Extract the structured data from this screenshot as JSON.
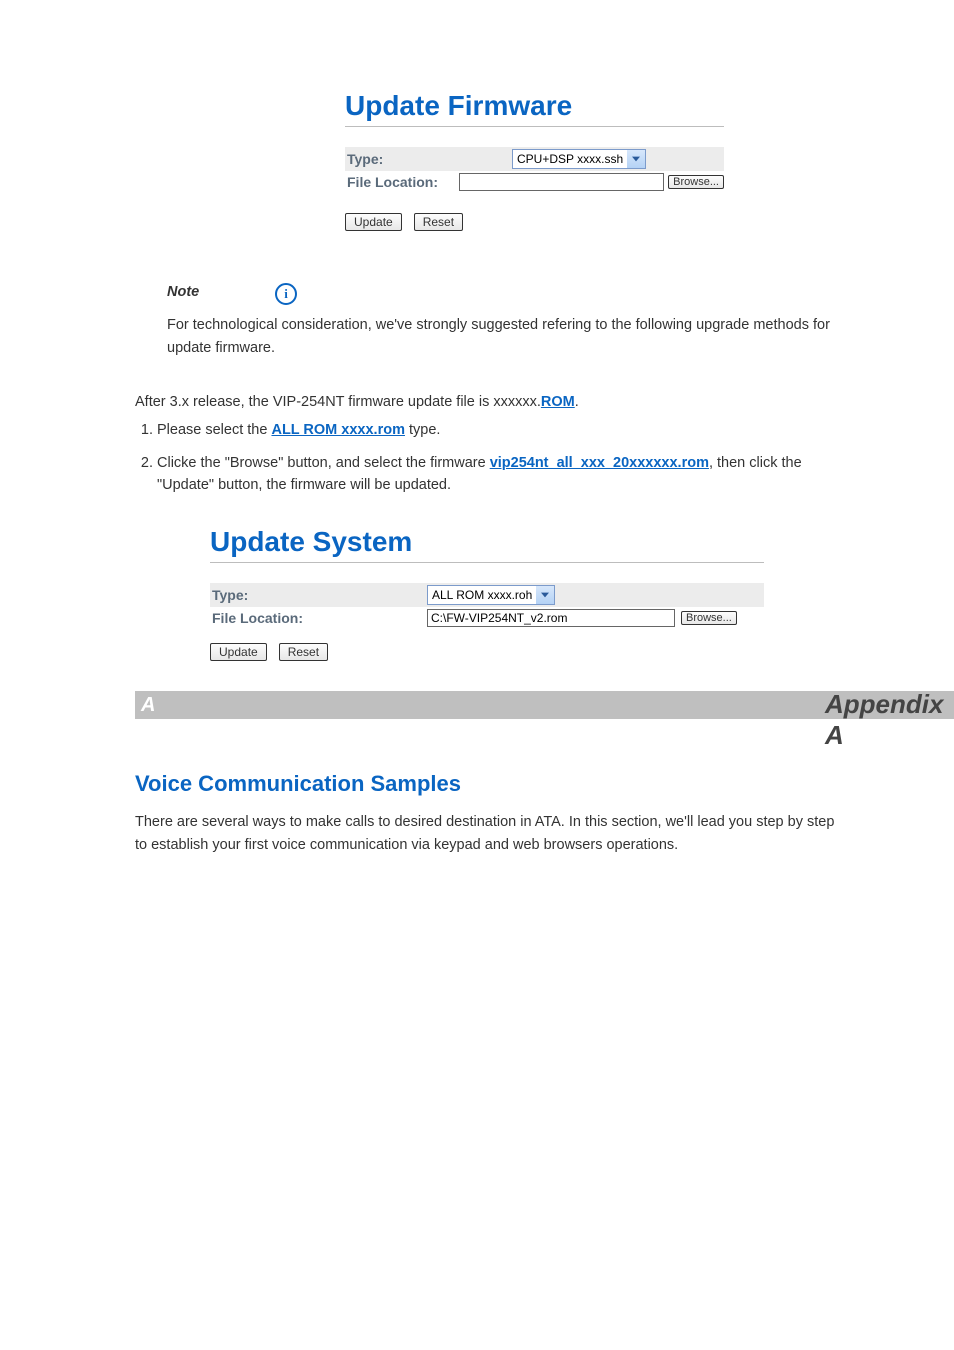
{
  "panel1": {
    "heading": "Update Firmware",
    "type_label": "Type:",
    "type_value": "CPU+DSP xxxx.ssh",
    "file_label": "File Location:",
    "file_value": "",
    "browse": "Browse...",
    "update": "Update",
    "reset": "Reset"
  },
  "note": {
    "title": "Note",
    "body_prefix": "For technological consideration, we've strongly suggested refering to the following upgrade methods for update firmware."
  },
  "instr": {
    "line1_a": "After 3.x release, the VIP-254NT firmware update file is xxxxxx.",
    "line1_b": "ROM",
    "line1_c": ".",
    "step1_a": "Please select the ",
    "step1_b": "ALL ROM xxxx.rom",
    "step1_c": " type.",
    "step2_a": "Clicke the ",
    "step2_b": "\"Browse\"",
    "step2_c": " button, and select the firmware ",
    "step2_d": "vip254nt_all_xxx_20xxxxxx.rom",
    "step2_e": ", then click the \"Update\" button, the firmware will be updated."
  },
  "panel2": {
    "heading": "Update System",
    "type_label": "Type:",
    "type_value": "ALL ROM xxxx.roh",
    "file_label": "File Location:",
    "file_value": "C:\\FW-VIP254NT_v2.rom",
    "browse": "Browse...",
    "update": "Update",
    "reset": "Reset"
  },
  "appendix": {
    "letter": "A",
    "title": "Voice Communication Samples",
    "body": "There are several ways to make calls to desired destination in ATA. In this section, we'll lead you step by step to establish your first voice communication via keypad and web browsers operations."
  },
  "icons": {
    "info": "i"
  }
}
